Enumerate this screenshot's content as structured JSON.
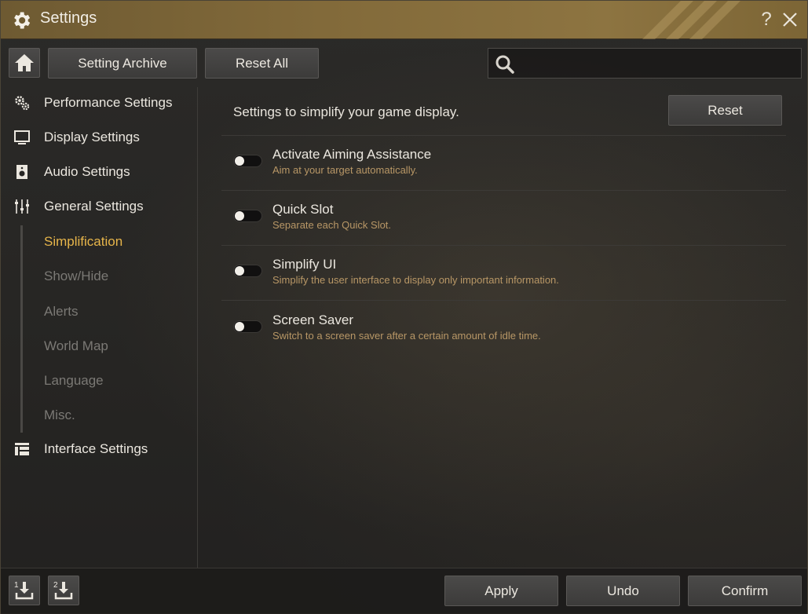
{
  "window": {
    "title": "Settings"
  },
  "toolbar": {
    "archive_label": "Setting Archive",
    "reset_all_label": "Reset All",
    "search_placeholder": "",
    "search_value": ""
  },
  "sidebar": {
    "items": [
      {
        "label": "Performance Settings",
        "icon": "gears-icon"
      },
      {
        "label": "Display Settings",
        "icon": "monitor-icon"
      },
      {
        "label": "Audio Settings",
        "icon": "speaker-icon"
      },
      {
        "label": "General Settings",
        "icon": "sliders-icon"
      },
      {
        "label": "Interface Settings",
        "icon": "layout-icon"
      }
    ],
    "sub_items": [
      {
        "label": "Simplification",
        "active": true
      },
      {
        "label": "Show/Hide",
        "active": false
      },
      {
        "label": "Alerts",
        "active": false
      },
      {
        "label": "World Map",
        "active": false
      },
      {
        "label": "Language",
        "active": false
      },
      {
        "label": "Misc.",
        "active": false
      }
    ]
  },
  "content": {
    "description": "Settings to simplify your game display.",
    "reset_label": "Reset",
    "options": [
      {
        "title": "Activate Aiming Assistance",
        "subtitle": "Aim at your target automatically.",
        "enabled": false
      },
      {
        "title": "Quick Slot",
        "subtitle": "Separate each Quick Slot.",
        "enabled": false
      },
      {
        "title": "Simplify UI",
        "subtitle": "Simplify the user interface to display only important information.",
        "enabled": false
      },
      {
        "title": "Screen Saver",
        "subtitle": "Switch to a screen saver after a certain amount of idle time.",
        "enabled": false
      }
    ]
  },
  "footer": {
    "slot1_label": "1",
    "slot2_label": "2",
    "apply_label": "Apply",
    "undo_label": "Undo",
    "confirm_label": "Confirm"
  },
  "colors": {
    "titlebar": "#826a3a",
    "active_accent": "#e7b54a",
    "subtitle": "#b89766"
  }
}
